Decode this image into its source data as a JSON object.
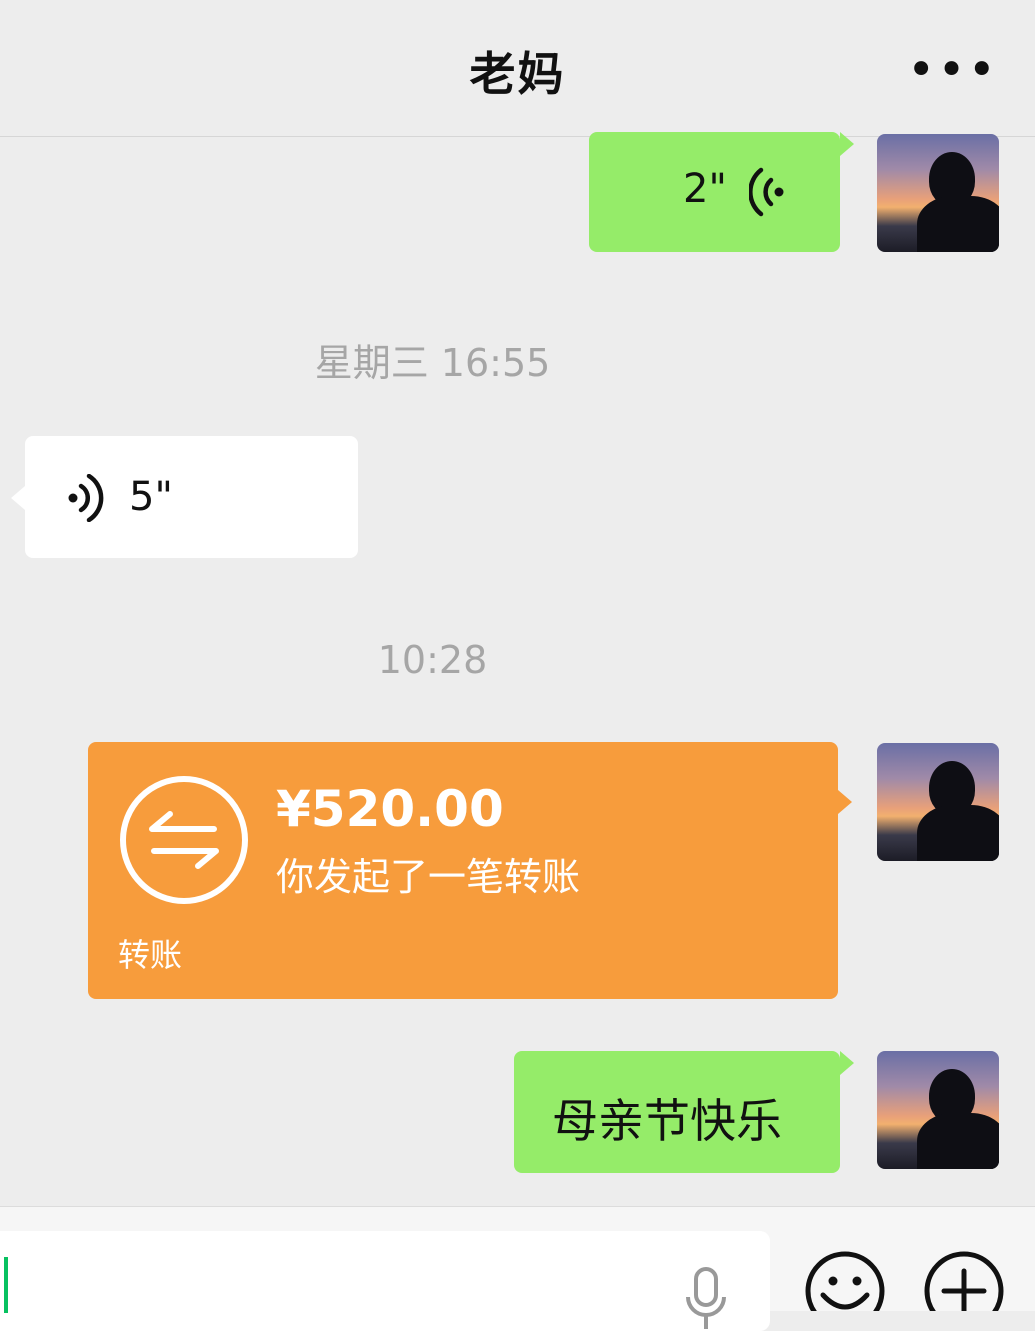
{
  "header": {
    "title": "老妈",
    "more_label": "•••"
  },
  "messages": {
    "voice_out": {
      "duration": "2\""
    },
    "ts1": "星期三 16:55",
    "voice_in": {
      "duration": "5\""
    },
    "ts2": "10:28",
    "transfer": {
      "amount": "¥520.00",
      "description": "你发起了一笔转账",
      "label": "转账"
    },
    "text_out": {
      "text": "母亲节快乐"
    }
  },
  "colors": {
    "outgoing_bubble": "#95ec69",
    "incoming_bubble": "#ffffff",
    "transfer_card": "#f79c3c",
    "background": "#ededed",
    "caret": "#07c160"
  },
  "icons": {
    "more": "more-dots-icon",
    "voice": "voice-wave-icon",
    "transfer": "transfer-arrows-icon",
    "mic": "microphone-icon",
    "emoji": "emoji-icon",
    "plus": "plus-circle-icon"
  }
}
